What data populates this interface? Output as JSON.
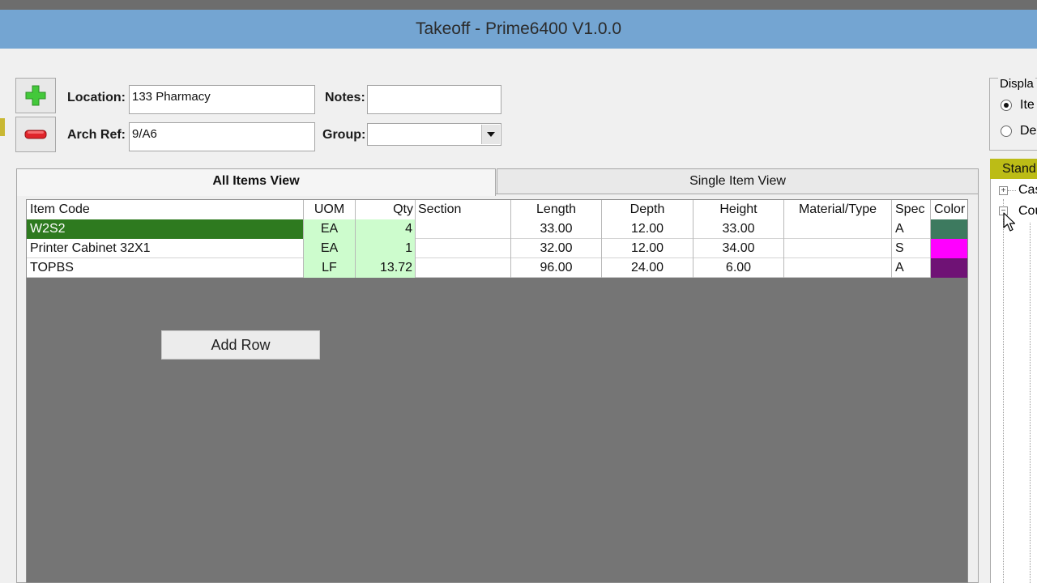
{
  "window": {
    "title": "Takeoff - Prime6400 V1.0.0"
  },
  "toolbar": {
    "add_icon": "green-plus-icon",
    "remove_icon": "red-minus-icon"
  },
  "form": {
    "location_label": "Location:",
    "location_value": "133 Pharmacy",
    "notes_label": "Notes:",
    "notes_value": "",
    "archref_label": "Arch Ref:",
    "archref_value": "9/A6",
    "group_label": "Group:",
    "group_value": ""
  },
  "tabs": [
    {
      "label": "All Items View",
      "active": true
    },
    {
      "label": "Single Item View",
      "active": false
    }
  ],
  "grid": {
    "columns": [
      "Item Code",
      "UOM",
      "Qty",
      "Section",
      "Length",
      "Depth",
      "Height",
      "Material/Type",
      "Spec",
      "Color"
    ],
    "rows": [
      {
        "item_code": "W2S2",
        "uom": "EA",
        "qty": "4",
        "section": "",
        "length": "33.00",
        "depth": "12.00",
        "height": "33.00",
        "material": "",
        "spec": "A",
        "color": "#3d7a5f",
        "selected": true
      },
      {
        "item_code": "Printer Cabinet 32X1",
        "uom": "EA",
        "qty": "1",
        "section": "",
        "length": "32.00",
        "depth": "12.00",
        "height": "34.00",
        "material": "",
        "spec": "S",
        "color": "#ff00ff",
        "selected": false
      },
      {
        "item_code": "TOPBS",
        "uom": "LF",
        "qty": "13.72",
        "section": "",
        "length": "96.00",
        "depth": "24.00",
        "height": "6.00",
        "material": "",
        "spec": "A",
        "color": "#6f1275",
        "selected": false
      }
    ],
    "add_row_label": "Add Row"
  },
  "display": {
    "label": "Displa",
    "options": [
      {
        "label": "Ite",
        "selected": true
      },
      {
        "label": "De",
        "selected": false
      }
    ]
  },
  "standards": {
    "header": "Stand",
    "tree": [
      {
        "label": "Cas",
        "expander": "+"
      },
      {
        "label": "Cou",
        "expander": "−"
      }
    ]
  },
  "colors": {
    "titlebar": "#74a5d2",
    "selected_row": "#2e7a1f",
    "qty_bg": "#cdfccd",
    "grid_bg": "#757575",
    "standard_header": "#bcbc16"
  }
}
